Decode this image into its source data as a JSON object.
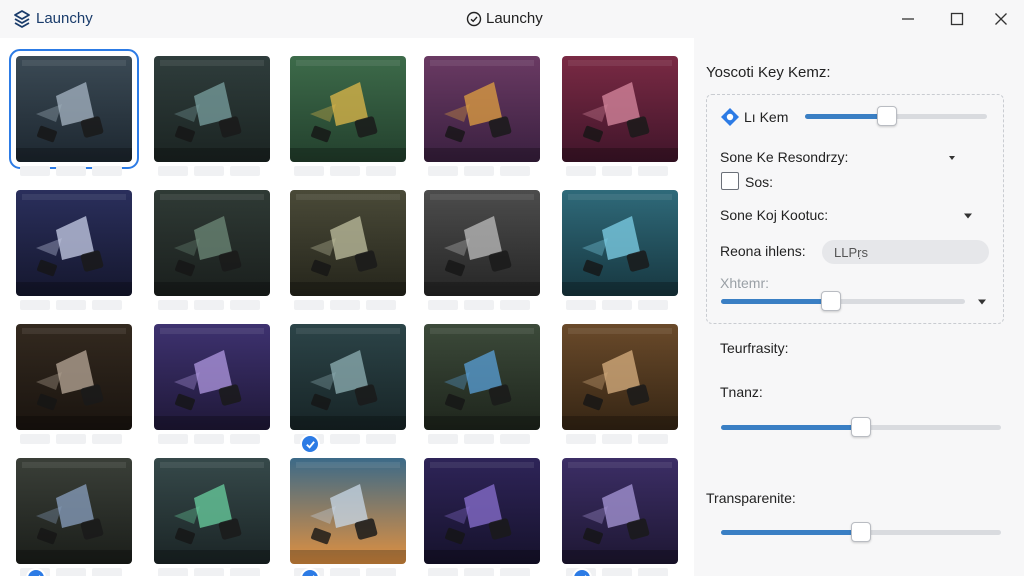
{
  "app": {
    "name": "Launchy",
    "window_title": "Launchy"
  },
  "colors": {
    "accent": "#2c7be5",
    "slider_fill": "#3a7fc4"
  },
  "gallery": {
    "tiles": [
      {
        "row": 0,
        "col": 0,
        "bg1": "#3b4a55",
        "bg2": "#1d2730",
        "accent": "#a7b6c4",
        "selected": true
      },
      {
        "row": 0,
        "col": 1,
        "bg1": "#2f3d3c",
        "bg2": "#1b2422",
        "accent": "#7aa0a0",
        "selected": false
      },
      {
        "row": 0,
        "col": 2,
        "bg1": "#3d6b4a",
        "bg2": "#23402d",
        "accent": "#e0b84a",
        "selected": false
      },
      {
        "row": 0,
        "col": 3,
        "bg1": "#6a3a63",
        "bg2": "#3a2040",
        "accent": "#e0a040",
        "selected": false
      },
      {
        "row": 0,
        "col": 4,
        "bg1": "#7a2a44",
        "bg2": "#40152a",
        "accent": "#d88aa0",
        "selected": false
      },
      {
        "row": 1,
        "col": 0,
        "bg1": "#2a2f5c",
        "bg2": "#15172e",
        "accent": "#c8cfe8",
        "selected": false
      },
      {
        "row": 1,
        "col": 1,
        "bg1": "#2f3a35",
        "bg2": "#1a1f1d",
        "accent": "#6d8a78",
        "selected": false
      },
      {
        "row": 1,
        "col": 2,
        "bg1": "#4a4a38",
        "bg2": "#25251b",
        "accent": "#c0c0a0",
        "selected": false
      },
      {
        "row": 1,
        "col": 3,
        "bg1": "#4c4c4c",
        "bg2": "#262626",
        "accent": "#bdbdbd",
        "selected": false
      },
      {
        "row": 1,
        "col": 4,
        "bg1": "#2f6a7a",
        "bg2": "#173740",
        "accent": "#7fd0e8",
        "selected": false
      },
      {
        "row": 2,
        "col": 0,
        "bg1": "#33291f",
        "bg2": "#1a140f",
        "accent": "#b8a898",
        "selected": false
      },
      {
        "row": 2,
        "col": 1,
        "bg1": "#3e3270",
        "bg2": "#1f1838",
        "accent": "#b098e0",
        "selected": false
      },
      {
        "row": 2,
        "col": 2,
        "bg1": "#2c4448",
        "bg2": "#172426",
        "accent": "#8fb0b4",
        "selected": false,
        "checked": true
      },
      {
        "row": 2,
        "col": 3,
        "bg1": "#3c4a3a",
        "bg2": "#1e251c",
        "accent": "#5aa0d8",
        "selected": false
      },
      {
        "row": 2,
        "col": 4,
        "bg1": "#6a4a2a",
        "bg2": "#352514",
        "accent": "#d8b080",
        "selected": false
      },
      {
        "row": 3,
        "col": 0,
        "bg1": "#3a3f38",
        "bg2": "#1b1e1a",
        "accent": "#8aa0c0",
        "selected": false,
        "checked": true
      },
      {
        "row": 3,
        "col": 1,
        "bg1": "#36494a",
        "bg2": "#1b2526",
        "accent": "#6ad0a0",
        "selected": false
      },
      {
        "row": 3,
        "col": 2,
        "bg1": "#3c6a88",
        "bg2": "#e09040",
        "accent": "#c8d8e8",
        "selected": false,
        "checked": true
      },
      {
        "row": 3,
        "col": 3,
        "bg1": "#2e2458",
        "bg2": "#16122c",
        "accent": "#8a70d0",
        "selected": false
      },
      {
        "row": 3,
        "col": 4,
        "bg1": "#3c2e66",
        "bg2": "#1e1733",
        "accent": "#a898d8",
        "selected": false,
        "checked": true
      }
    ]
  },
  "panel": {
    "title": "Yoscoti Key Kemz:",
    "key_item_label": "Lı Kem",
    "key_item_slider": 0.45,
    "dropdown1_label": "Sone Ke Resondrzy:",
    "checkbox_label": "Sos:",
    "checkbox_checked": false,
    "dropdown2_label": "Sone Koj Kootuc:",
    "field_label": "Reona ihlens:",
    "field_value": "LLPṛs",
    "muted_label": "Xhtemr:",
    "muted_slider": 0.45,
    "tearfrasity_label": "Teurfrasity:",
    "tranz_label": "Tnanz:",
    "tranz_slider": 0.5,
    "transparente_label": "Transparenite:",
    "transparente_slider": 0.5
  }
}
